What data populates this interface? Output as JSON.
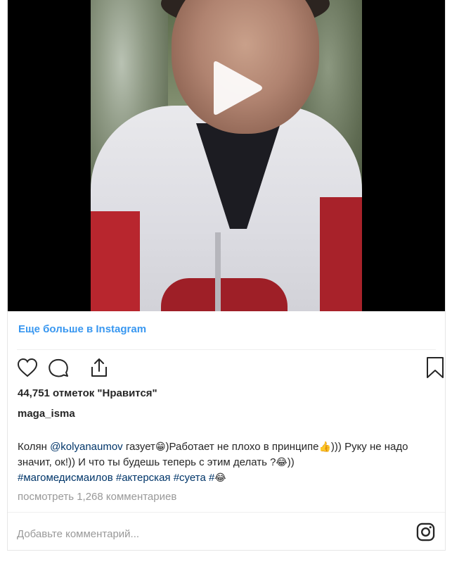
{
  "embed": {
    "more_link": "Еще больше в Instagram",
    "likes_text": "44,751 отметок \"Нравится\"",
    "username": "maga_isma",
    "caption": {
      "part1": "Колян ",
      "mention": "@kolyanaumov",
      "part2": " газует",
      "emoji1": "😁",
      "part3": ")Работает не плохо в принципе",
      "emoji2": "👍",
      "part4": "))) Руку не надо значит, ок!)) И что ты будешь теперь с этим делать ?",
      "emoji3": "😂",
      "part5": "))",
      "tag1": "#магомедисмаилов",
      "tag2": "#актерская",
      "tag3": "#суета",
      "tag4": "#",
      "emoji4": "😂"
    },
    "view_comments": "посмотреть 1,268 комментариев",
    "comment_placeholder": "Добавьте комментарий..."
  },
  "icons": {
    "play": "play-icon",
    "like": "heart-icon",
    "comment": "comment-icon",
    "share": "share-icon",
    "save": "bookmark-icon",
    "instagram": "instagram-icon"
  },
  "colors": {
    "link_blue": "#3897f0",
    "text": "#262626",
    "muted": "#999999",
    "mention": "#003569"
  }
}
